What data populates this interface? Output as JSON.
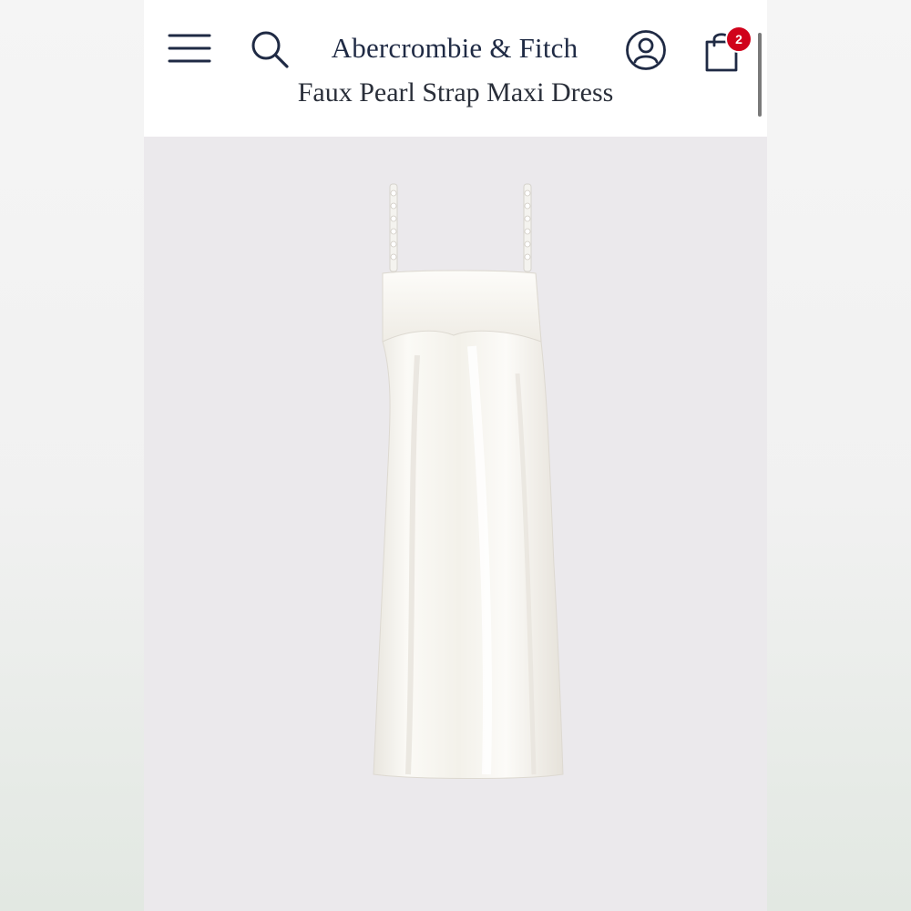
{
  "header": {
    "brand": "Abercrombie & Fitch",
    "product_title": "Faux Pearl Strap Maxi Dress",
    "cart_count": "2"
  },
  "icons": {
    "menu": "hamburger-menu-icon",
    "search": "search-icon",
    "account": "account-icon",
    "cart": "shopping-bag-icon"
  },
  "colors": {
    "brand_navy": "#1f2a44",
    "badge_red": "#d0021b",
    "image_background": "#ebe9ec",
    "dress_white": "#f8f6f1"
  }
}
